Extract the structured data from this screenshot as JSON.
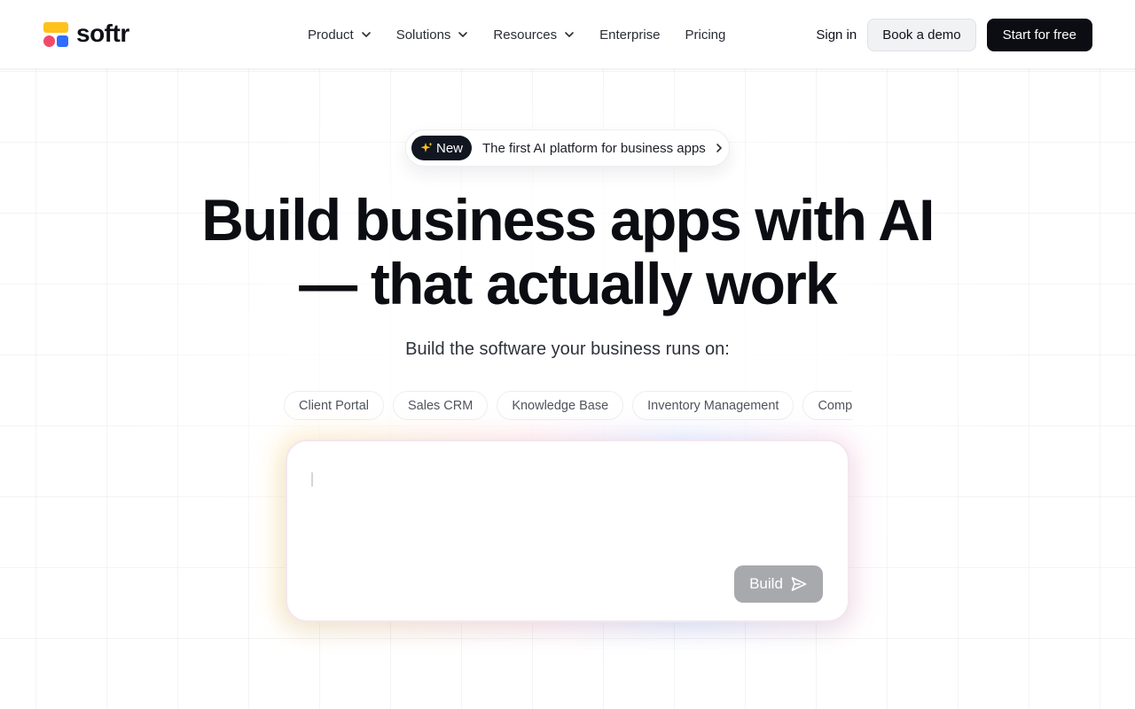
{
  "header": {
    "brand": "softr",
    "nav": [
      {
        "label": "Product",
        "has_menu": true
      },
      {
        "label": "Solutions",
        "has_menu": true
      },
      {
        "label": "Resources",
        "has_menu": true
      },
      {
        "label": "Enterprise",
        "has_menu": false
      },
      {
        "label": "Pricing",
        "has_menu": false
      }
    ],
    "sign_in": "Sign in",
    "book_demo": "Book a demo",
    "start_free": "Start for free"
  },
  "announcement": {
    "badge": "New",
    "text": "The first AI platform for business apps"
  },
  "hero": {
    "headline_line1": "Build business apps with AI",
    "headline_line2": "— that actually work",
    "subline": "Build the software your business runs on:"
  },
  "chips": [
    "Client Portal",
    "Sales CRM",
    "Knowledge Base",
    "Inventory Management",
    "Compa"
  ],
  "prompt": {
    "value": "",
    "placeholder": "",
    "build_label": "Build"
  },
  "colors": {
    "brand_yellow": "#ffc21a",
    "brand_pink": "#f2496b",
    "brand_blue": "#2f6dff",
    "primary_dark": "#0b0d12",
    "build_disabled": "#a8a9ad"
  },
  "icons": {
    "menu_chevron": "chevron-down-icon",
    "announce_chevron": "chevron-right-icon",
    "badge_icon": "sparkle-icon",
    "build_icon": "send-icon"
  }
}
